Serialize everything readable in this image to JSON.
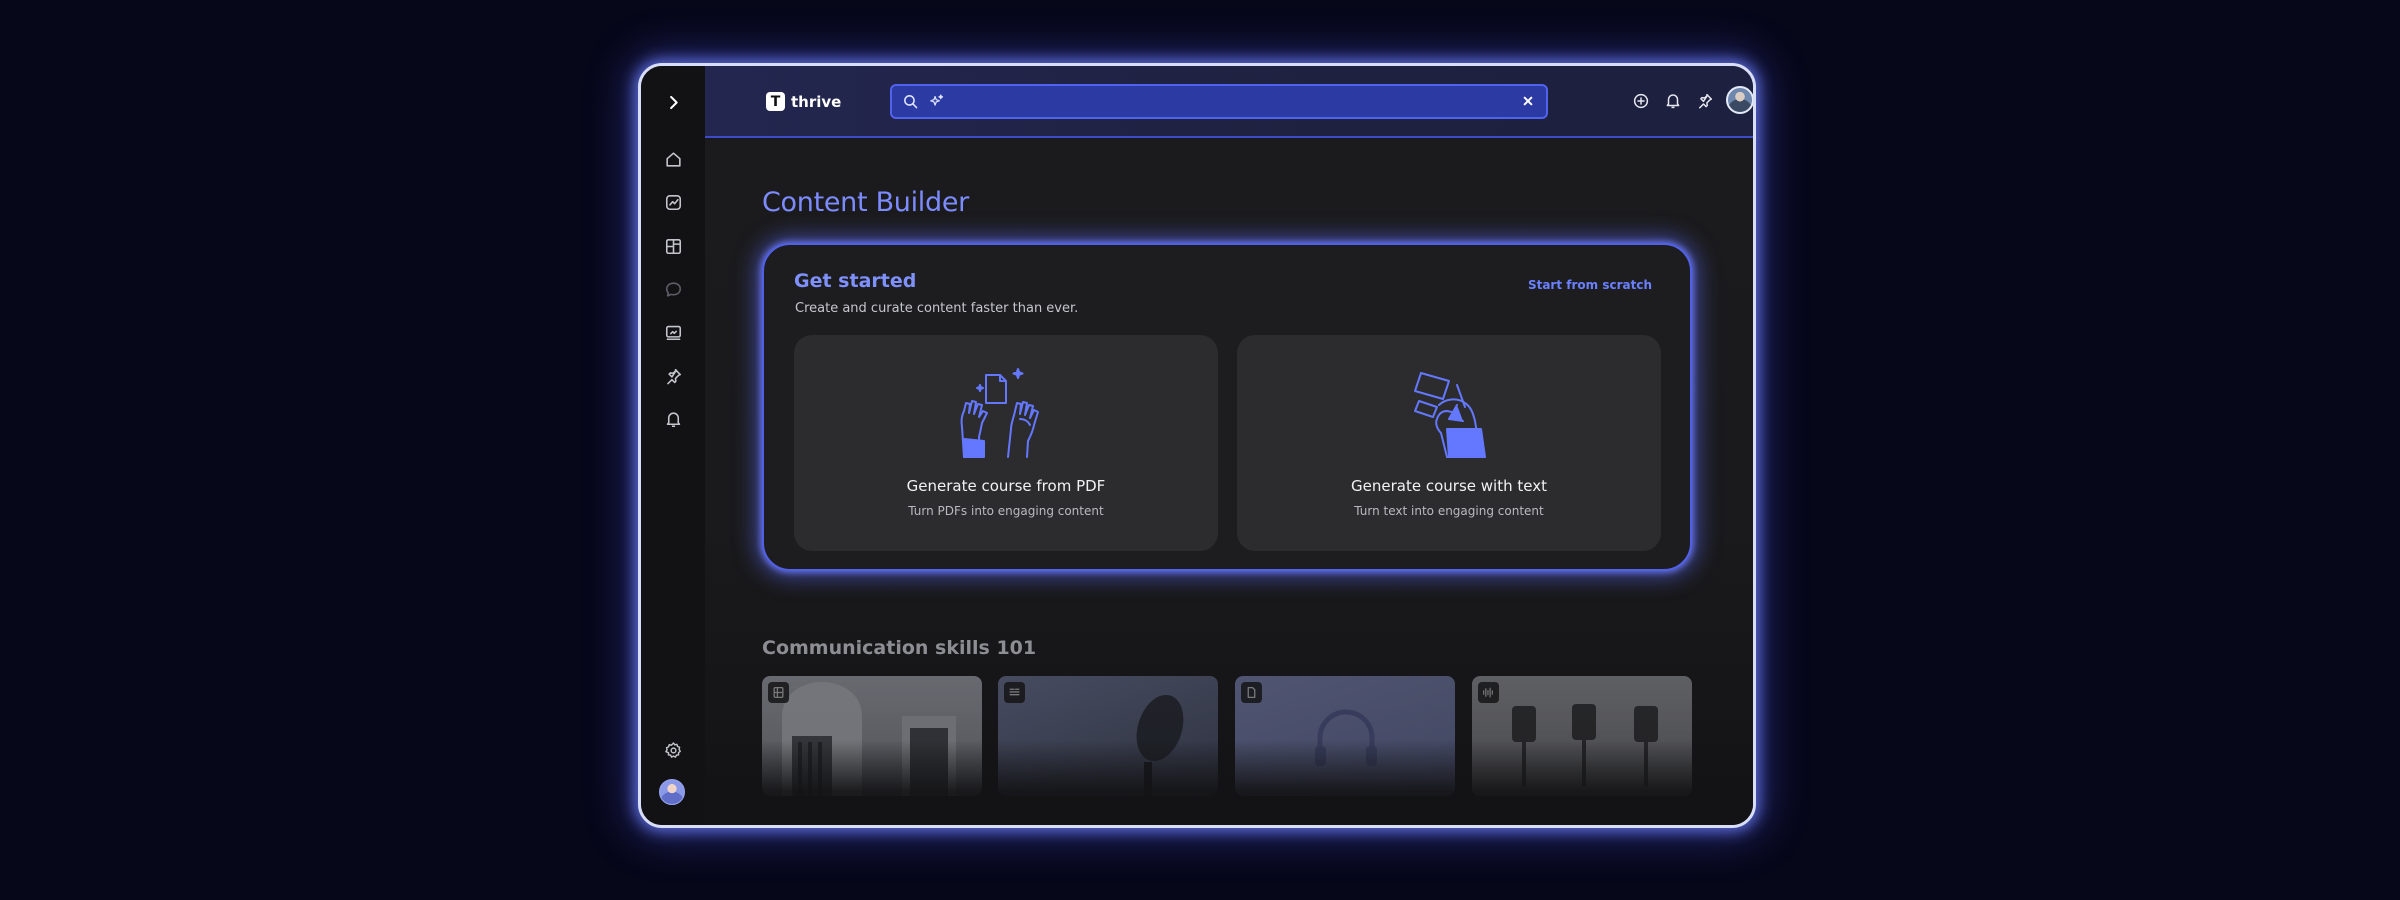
{
  "app": {
    "logo_letter": "T",
    "name": "thrive"
  },
  "search": {
    "value": "",
    "placeholder": ""
  },
  "page": {
    "title": "Content Builder"
  },
  "get_started": {
    "title": "Get started",
    "subtitle": "Create and curate content faster than ever.",
    "scratch_link": "Start from scratch",
    "options": [
      {
        "title": "Generate course from PDF",
        "subtitle": "Turn PDFs into engaging content"
      },
      {
        "title": "Generate course with text",
        "subtitle": "Turn text into engaging content"
      }
    ]
  },
  "section": {
    "title": "Communication skills 101"
  },
  "colors": {
    "accent": "#7c8cff",
    "window_glow": "#6e82ff",
    "search_bg": "#2c3aa3",
    "card_bg": "#2c2c2f",
    "illustration_fill": "#6478ff"
  },
  "icons": {
    "sidebar": [
      "chevron-right-icon",
      "home-icon",
      "analytics-icon",
      "layout-icon",
      "chat-icon",
      "media-icon",
      "pin-icon",
      "bell-icon",
      "settings-icon",
      "avatar"
    ],
    "topbar": [
      "search-icon",
      "sparkle-icon",
      "close-icon",
      "add-circle-icon",
      "bell-icon",
      "pin-icon",
      "avatar",
      "chevron-down-icon"
    ],
    "thumbnails": [
      "video-icon",
      "text-icon",
      "document-icon",
      "audio-icon"
    ]
  }
}
